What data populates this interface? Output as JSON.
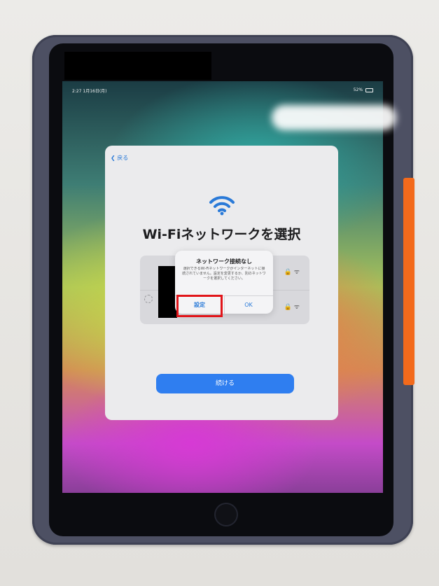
{
  "status_bar": {
    "time_date": "2:27 1月16日(月)",
    "battery": "52%"
  },
  "nav": {
    "back_label": "戻る"
  },
  "page": {
    "title": "Wi-Fiネットワークを選択"
  },
  "alert": {
    "title": "ネットワーク接続なし",
    "body": "選択できるWi-Fiネットワークがインターネットに接続されていません。設定を変更するか、別のネットワークを選択してください。",
    "settings_label": "設定",
    "ok_label": "OK"
  },
  "actions": {
    "continue_label": "続ける"
  },
  "icons": [
    "back-chevron-icon",
    "wifi-icon",
    "lock-icon",
    "wifi-signal-icon",
    "loading-spinner-icon"
  ],
  "colors": {
    "accent": "#2f7ef0",
    "highlight": "#e1151a",
    "case_orange": "#f36a1b"
  }
}
